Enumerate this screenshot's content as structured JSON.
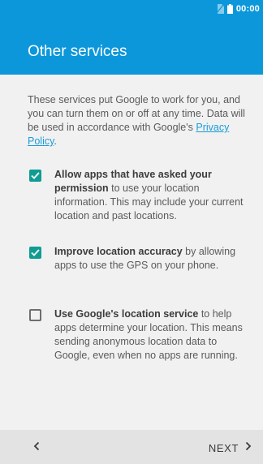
{
  "status_bar": {
    "time": "00:00",
    "icons": [
      "no-sim-icon",
      "battery-icon"
    ]
  },
  "header": {
    "title": "Other services"
  },
  "intro": {
    "text_before_link": "These services put Google to work for you, and you can turn them on or off at any time. Data will be used in accordance with Google's ",
    "link_text": "Privacy Policy",
    "text_after_link": "."
  },
  "options": [
    {
      "bold": "Allow apps that have asked your permission",
      "rest": " to use your location information. This may include your current location and past locations.",
      "checked": true
    },
    {
      "bold": "Improve location accuracy",
      "rest": " by allowing apps to use the GPS on your phone.",
      "checked": true
    },
    {
      "bold": "Use Google's location service",
      "rest": " to help apps determine your location. This means sending anonymous location data to Google, even when no apps are running.",
      "checked": false
    }
  ],
  "footer": {
    "next_label": "NEXT"
  },
  "colors": {
    "header_bg": "#0c97db",
    "checkbox_checked": "#0f9c92",
    "link": "#1a9cd8",
    "footer_bg": "#e3e3e3"
  }
}
